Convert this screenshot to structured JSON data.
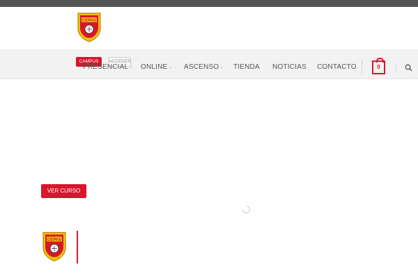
{
  "brand": {
    "logo_text": "CEPAS",
    "accent_color": "#d7162b",
    "dark_bar_color": "#555555"
  },
  "header": {
    "campus_label": "CAMPUS",
    "acceder_label": "ACCEDER"
  },
  "nav": {
    "items": [
      {
        "label": "PRESENCIAL",
        "has_dropdown": true
      },
      {
        "label": "ONLINE",
        "has_dropdown": true
      },
      {
        "label": "ASCENSO",
        "has_dropdown": true
      },
      {
        "label": "TIENDA",
        "has_dropdown": false
      },
      {
        "label": "NOTICIAS",
        "has_dropdown": false
      },
      {
        "label": "CONTACTO",
        "has_dropdown": false
      }
    ],
    "cart_count": "0",
    "dropdown_icon": "chevron-down-icon",
    "cart_icon": "shopping-bag-icon",
    "search_icon": "search-icon"
  },
  "hero": {
    "cta_label": "VER CURSO"
  }
}
